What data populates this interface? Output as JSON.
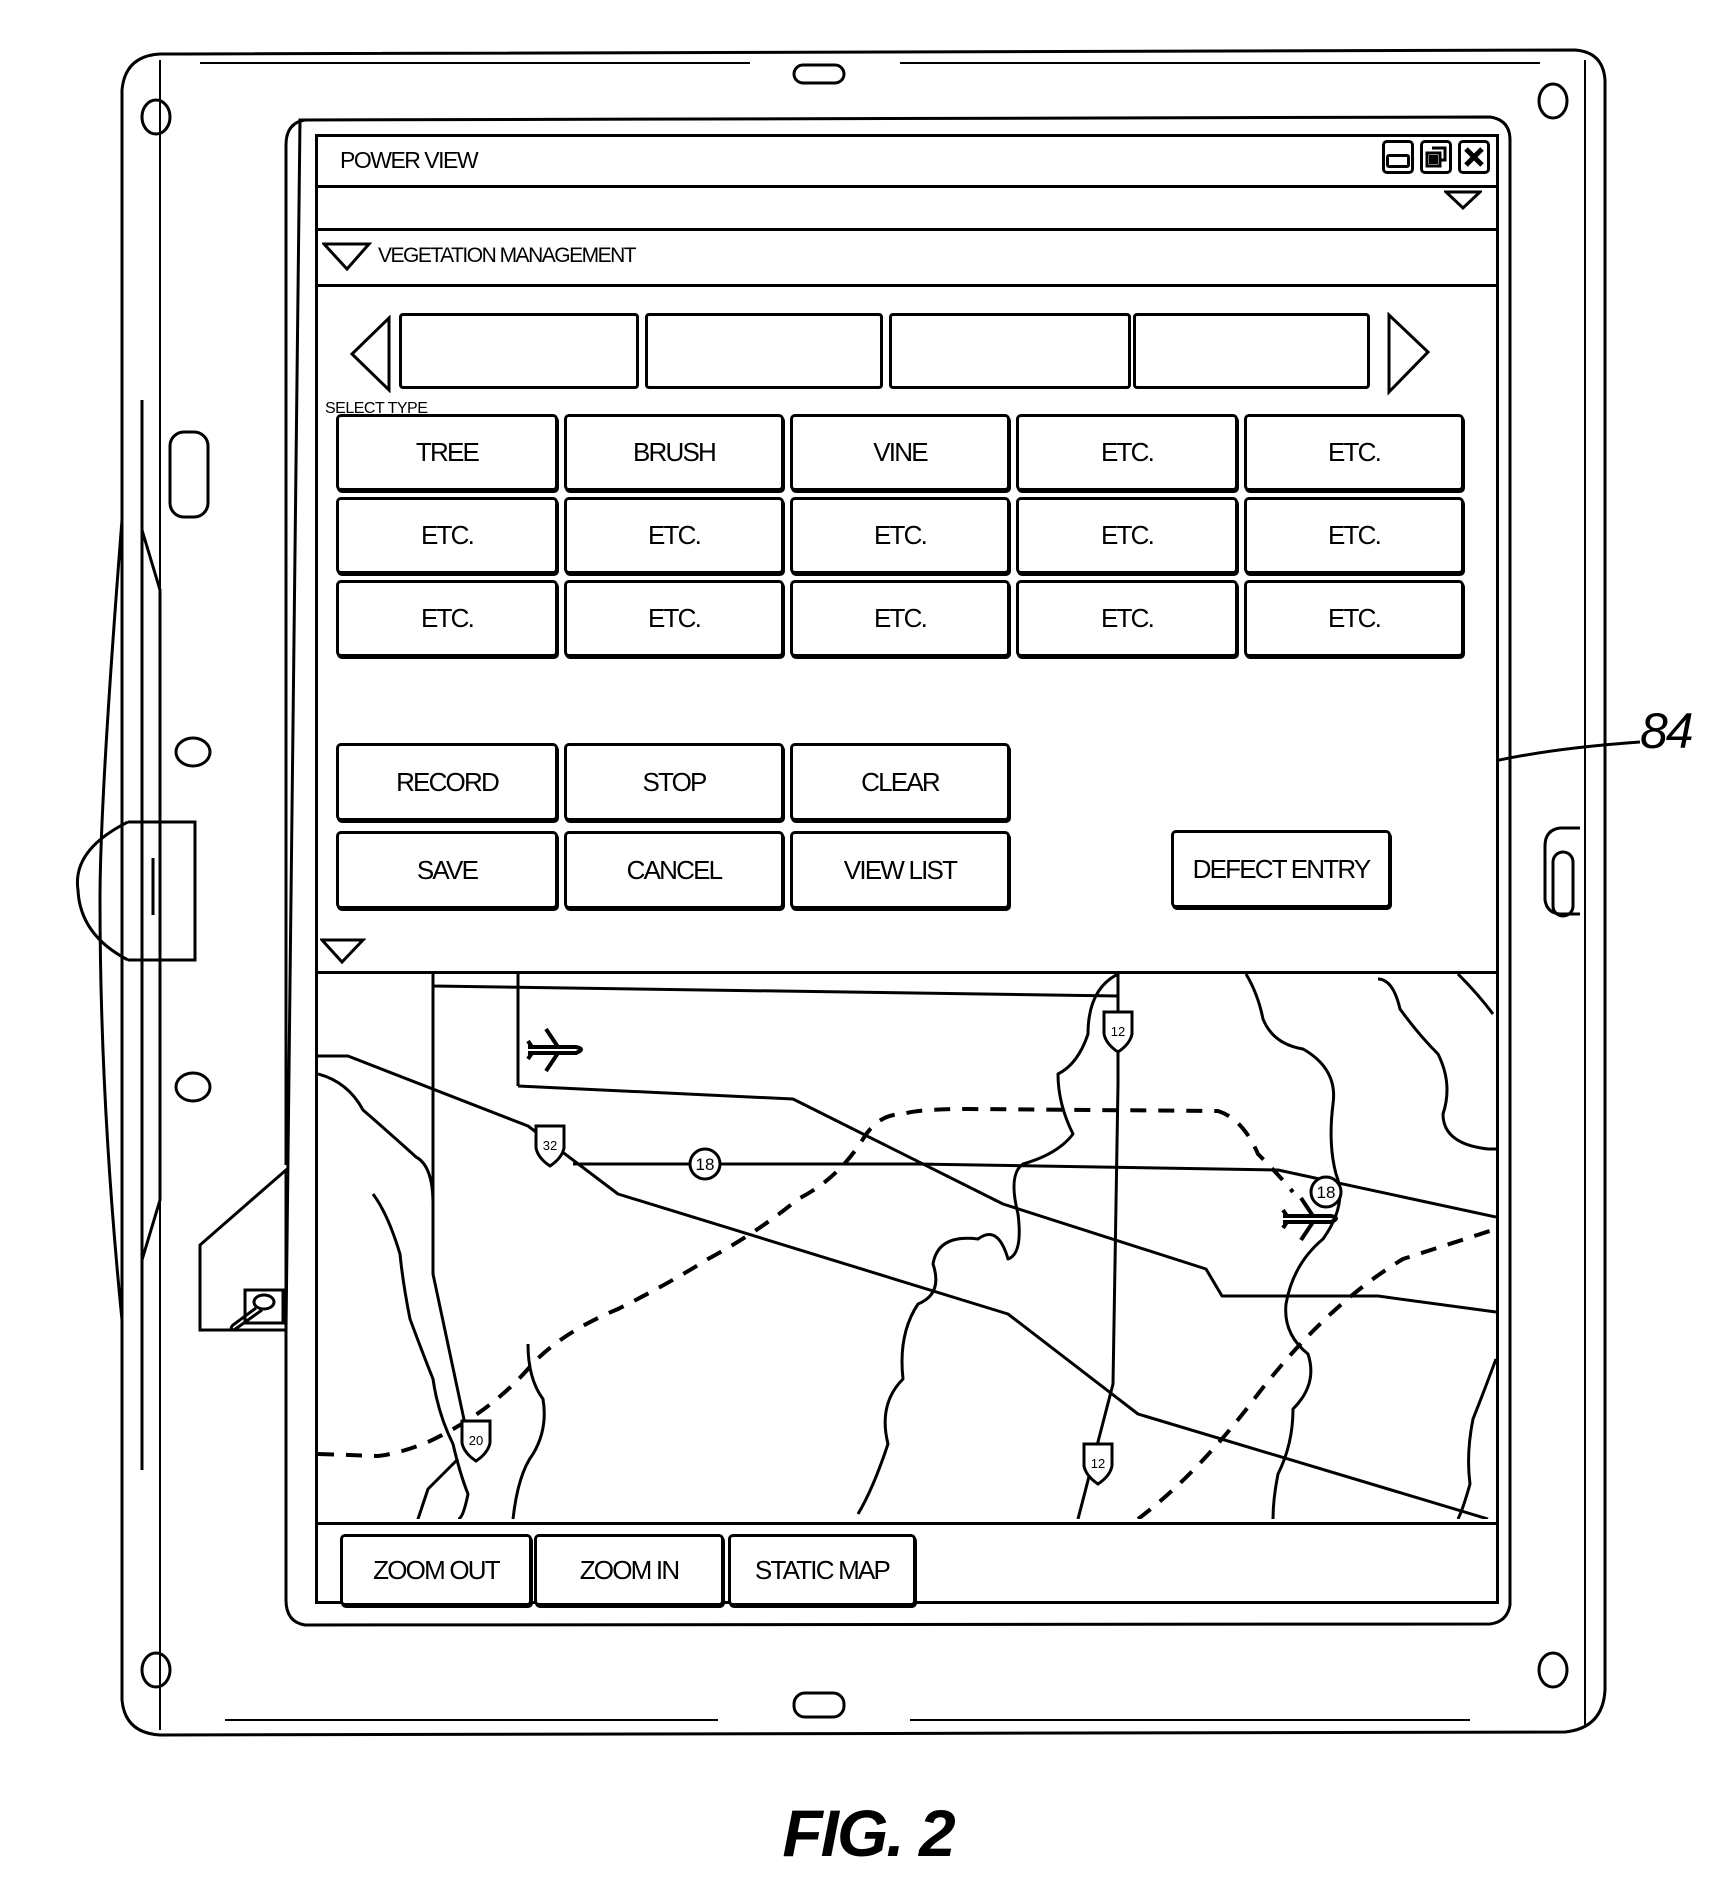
{
  "window": {
    "title": "POWER VIEW",
    "controls": [
      {
        "name": "minimize",
        "icon": "minimize-icon"
      },
      {
        "name": "restore",
        "icon": "restore-icon"
      },
      {
        "name": "close",
        "icon": "close-icon"
      }
    ]
  },
  "menubar": {
    "dropdown_icon": "chevron-down-icon"
  },
  "section": {
    "label": "VEGETATION MANAGEMENT",
    "collapse_icon": "triangle-down-icon"
  },
  "carousel": {
    "prev_icon": "triangle-left-icon",
    "next_icon": "triangle-right-icon",
    "slots": [
      "",
      "",
      "",
      ""
    ]
  },
  "select_type": {
    "label": "SELECT TYPE",
    "options": [
      [
        "TREE",
        "BRUSH",
        "VINE",
        "ETC.",
        "ETC."
      ],
      [
        "ETC.",
        "ETC.",
        "ETC.",
        "ETC.",
        "ETC."
      ],
      [
        "ETC.",
        "ETC.",
        "ETC.",
        "ETC.",
        "ETC."
      ]
    ]
  },
  "actions": {
    "row1": [
      "RECORD",
      "STOP",
      "CLEAR"
    ],
    "row2": [
      "SAVE",
      "CANCEL",
      "VIEW LIST"
    ],
    "defect_entry": "DEFECT ENTRY"
  },
  "map": {
    "collapse_icon": "triangle-down-icon",
    "route_shields": [
      {
        "type": "interstate",
        "number": "12"
      },
      {
        "type": "interstate",
        "number": "32"
      },
      {
        "type": "state",
        "number": "18"
      },
      {
        "type": "state",
        "number": "18"
      },
      {
        "type": "interstate",
        "number": "20"
      },
      {
        "type": "interstate",
        "number": "12"
      }
    ],
    "airports": 2
  },
  "map_toolbar": {
    "buttons": [
      "ZOOM OUT",
      "ZOOM IN",
      "STATIC MAP"
    ]
  },
  "annotation": {
    "reference_numeral": "84",
    "points_to": "DEFECT ENTRY"
  },
  "figure": {
    "caption": "FIG. 2"
  }
}
